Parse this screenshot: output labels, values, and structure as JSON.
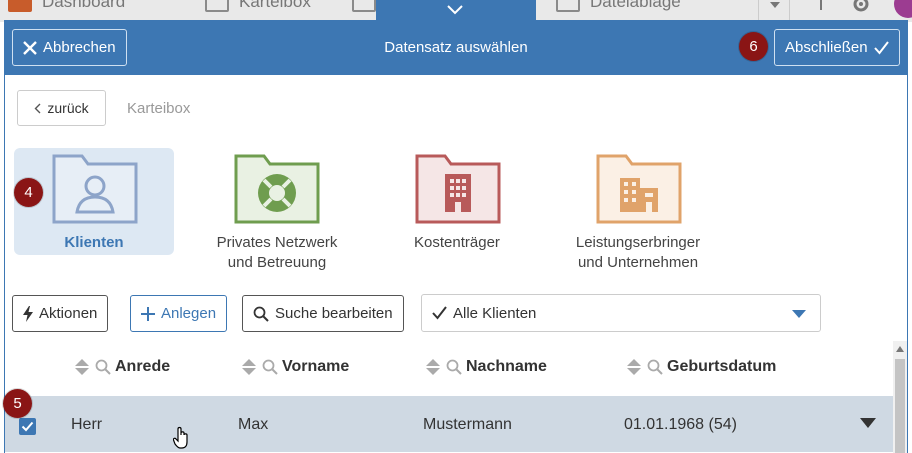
{
  "top_strip": {
    "tabs": [
      "Dashboard",
      "Karteibox",
      "Dateiablage"
    ]
  },
  "modal": {
    "title": "Datensatz auswählen",
    "cancel_label": "Abbrechen",
    "finish_label": "Abschließen"
  },
  "markers": [
    "4",
    "5",
    "6"
  ],
  "breadcrumb": {
    "back_label": "zurück",
    "current": "Karteibox"
  },
  "categories": [
    {
      "label": "Klienten",
      "icon": "person-folder-icon",
      "color": "#8da4c9",
      "active": true
    },
    {
      "label": "Privates Netzwerk und Betreuung",
      "icon": "lifebuoy-folder-icon",
      "color": "#6f9d4f"
    },
    {
      "label": "Kostenträger",
      "icon": "building-folder-icon",
      "color": "#b85a5a"
    },
    {
      "label": "Leistungserbringer und Unternehmen",
      "icon": "company-folder-icon",
      "color": "#e0a36a"
    }
  ],
  "toolbar": {
    "actions_label": "Aktionen",
    "create_label": "Anlegen",
    "search_label": "Suche bearbeiten",
    "filter_value": "Alle Klienten"
  },
  "table": {
    "columns": [
      "Anrede",
      "Vorname",
      "Nachname",
      "Geburtsdatum"
    ],
    "rows": [
      {
        "anrede": "Herr",
        "vorname": "Max",
        "nachname": "Mustermann",
        "geburtsdatum": "01.01.1968 (54)",
        "selected": true
      }
    ]
  },
  "colors": {
    "accent": "#3d77b3",
    "marker": "#8a1515",
    "selected_row": "#cfd9e3"
  }
}
